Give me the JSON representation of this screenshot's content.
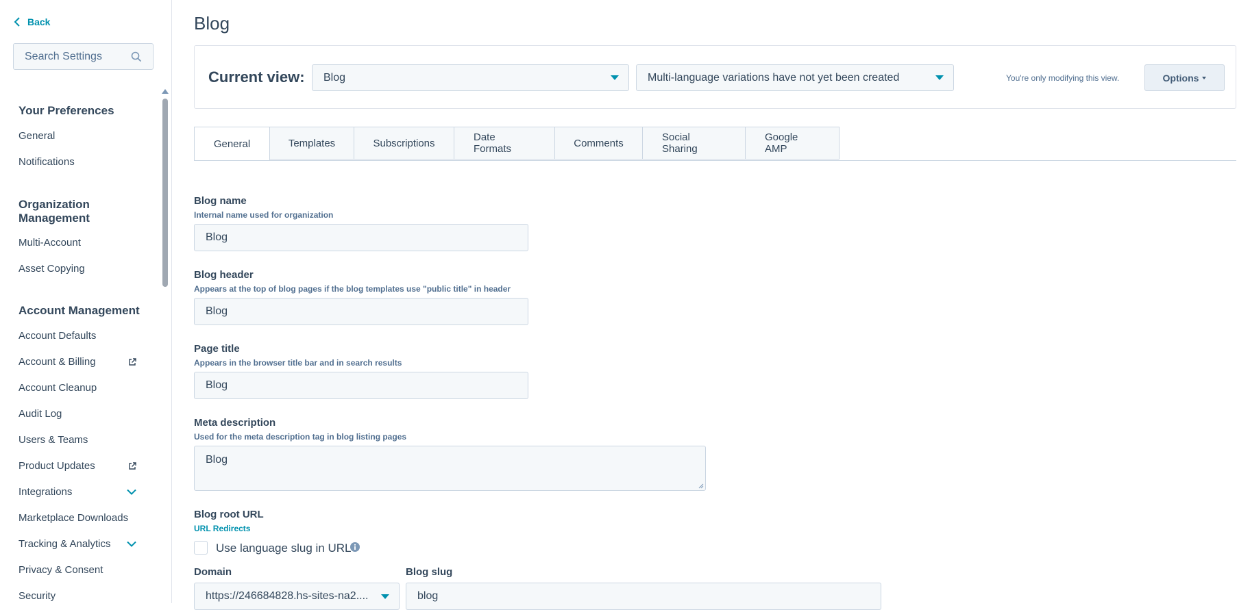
{
  "sidebar": {
    "back_label": "Back",
    "search_placeholder": "Search Settings",
    "sections": {
      "preferences": {
        "heading": "Your Preferences",
        "items": [
          "General",
          "Notifications"
        ]
      },
      "organization": {
        "heading": "Organization Management",
        "items": [
          "Multi-Account",
          "Asset Copying"
        ]
      },
      "account": {
        "heading": "Account Management",
        "items": [
          "Account Defaults",
          "Account & Billing",
          "Account Cleanup",
          "Audit Log",
          "Users & Teams",
          "Product Updates",
          "Integrations",
          "Marketplace Downloads",
          "Tracking & Analytics",
          "Privacy & Consent",
          "Security"
        ]
      }
    }
  },
  "header": {
    "title": "Blog"
  },
  "viewbar": {
    "label": "Current view:",
    "view_select": "Blog",
    "language_select": "Multi-language variations have not yet been created",
    "note": "You're only modifying this view.",
    "options_label": "Options"
  },
  "tabs": [
    "General",
    "Templates",
    "Subscriptions",
    "Date Formats",
    "Comments",
    "Social Sharing",
    "Google AMP"
  ],
  "form": {
    "blog_name": {
      "label": "Blog name",
      "help": "Internal name used for organization",
      "value": "Blog"
    },
    "blog_header": {
      "label": "Blog header",
      "help": "Appears at the top of blog pages if the blog templates use \"public title\" in header",
      "value": "Blog"
    },
    "page_title": {
      "label": "Page title",
      "help": "Appears in the browser title bar and in search results",
      "value": "Blog"
    },
    "meta_description": {
      "label": "Meta description",
      "help": "Used for the meta description tag in blog listing pages",
      "value": "Blog"
    },
    "root_url": {
      "label": "Blog root URL",
      "link": "URL Redirects",
      "checkbox_label": "Use language slug in URL"
    },
    "domain": {
      "label": "Domain",
      "value": "https://246684828.hs-sites-na2...."
    },
    "slug": {
      "label": "Blog slug",
      "value": "blog"
    }
  },
  "colors": {
    "accent": "#0091ae",
    "text": "#33475b",
    "border": "#cbd6e2",
    "field_bg": "#f5f8fa"
  }
}
